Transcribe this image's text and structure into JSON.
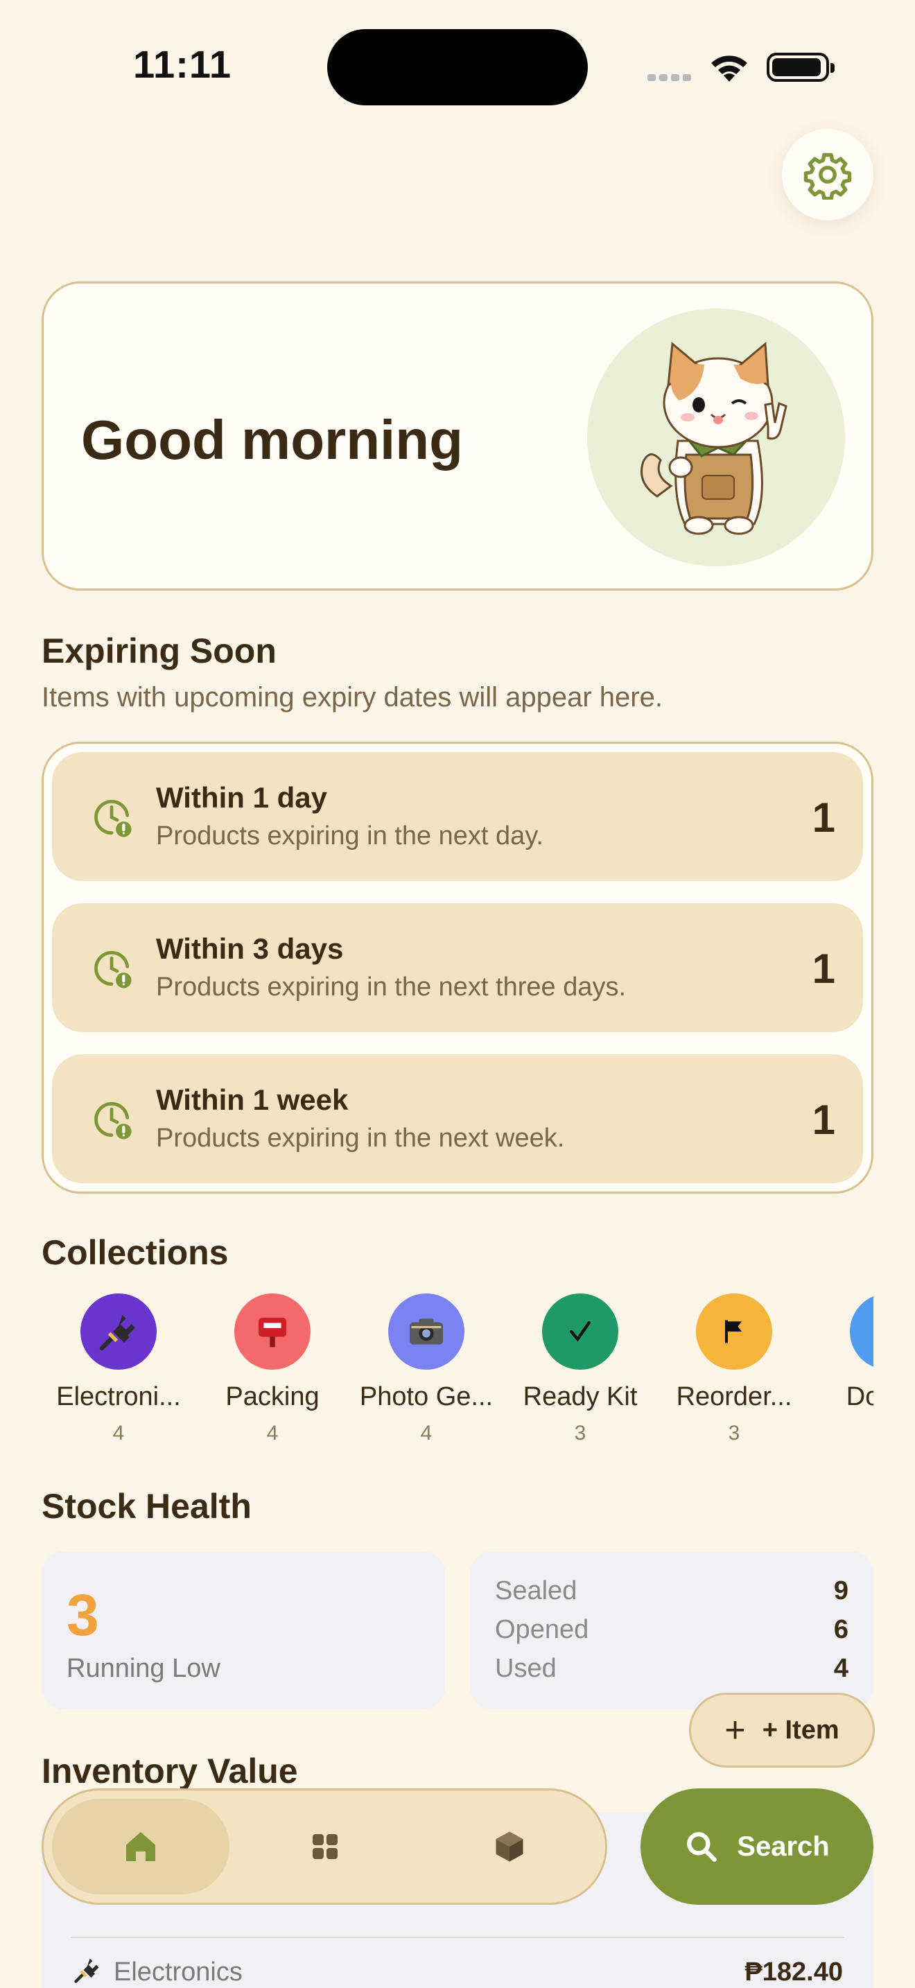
{
  "status_bar": {
    "time": "11:11"
  },
  "greeting": {
    "text": "Good morning"
  },
  "expiring": {
    "title": "Expiring Soon",
    "subtitle": "Items with upcoming expiry dates will appear here.",
    "rows": [
      {
        "title": "Within 1 day",
        "desc": "Products expiring in the next day.",
        "count": "1"
      },
      {
        "title": "Within 3 days",
        "desc": "Products expiring in the next three days.",
        "count": "1"
      },
      {
        "title": "Within 1 week",
        "desc": "Products expiring in the next week.",
        "count": "1"
      }
    ]
  },
  "collections": {
    "title": "Collections",
    "items": [
      {
        "name": "Electroni...",
        "count": "4",
        "color": "#6a35cc",
        "icon": "plug-icon"
      },
      {
        "name": "Packing",
        "count": "4",
        "color": "#f46a6a",
        "icon": "postbox-icon"
      },
      {
        "name": "Photo Ge...",
        "count": "4",
        "color": "#7b83f2",
        "icon": "camera-icon"
      },
      {
        "name": "Ready Kit",
        "count": "3",
        "color": "#1f9a67",
        "icon": "checkmark-icon"
      },
      {
        "name": "Reorder...",
        "count": "3",
        "color": "#f5b43a",
        "icon": "flag-icon"
      },
      {
        "name": "Docu...",
        "count": "",
        "color": "#4f9cf0",
        "icon": "document-icon"
      }
    ]
  },
  "stock_health": {
    "title": "Stock Health",
    "running_low_count": "3",
    "running_low_label": "Running Low",
    "stats": [
      {
        "label": "Sealed",
        "value": "9"
      },
      {
        "label": "Opened",
        "value": "6"
      },
      {
        "label": "Used",
        "value": "4"
      }
    ]
  },
  "add_item": {
    "label": "+ Item"
  },
  "inventory_value": {
    "title": "Inventory Value",
    "row": {
      "label": "Electronics",
      "value": "₱182.40",
      "icon": "plug-icon"
    }
  },
  "tabbar": {
    "tabs": [
      {
        "icon": "home-icon",
        "active": true
      },
      {
        "icon": "grid-icon",
        "active": false
      },
      {
        "icon": "box-icon",
        "active": false
      }
    ],
    "search_label": "Search"
  },
  "colors": {
    "accent_green": "#7d9638",
    "warning_orange": "#f0a23c",
    "card_tan": "#f2e3c2",
    "background": "#fdf5e8"
  }
}
